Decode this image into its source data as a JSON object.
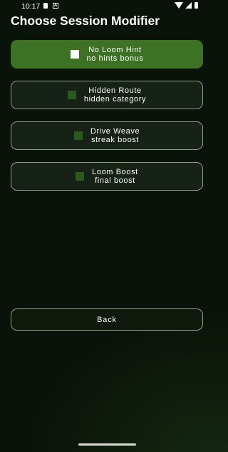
{
  "status_bar": {
    "time": "10:17",
    "notification_icons": [
      "sd-card-icon",
      "a-icon"
    ],
    "system_icons": [
      "wifi-icon",
      "signal-icon",
      "battery-icon"
    ]
  },
  "header": {
    "title": "Choose Session Modifier"
  },
  "modifiers": [
    {
      "title": "No Loom Hint",
      "subtitle": "no hints bonus",
      "selected": true
    },
    {
      "title": "Hidden Route",
      "subtitle": "hidden category",
      "selected": false
    },
    {
      "title": "Drive Weave",
      "subtitle": "streak boost",
      "selected": false
    },
    {
      "title": "Loom Boost",
      "subtitle": "final boost",
      "selected": false
    }
  ],
  "actions": {
    "back_label": "Back"
  },
  "colors": {
    "background": "#0a1309",
    "selected_option": "#3d7224",
    "option_background": "#162215",
    "option_border": "#8f9c86",
    "checkbox_unchecked": "#2c5a1e",
    "checkbox_checked": "#ffffff"
  }
}
